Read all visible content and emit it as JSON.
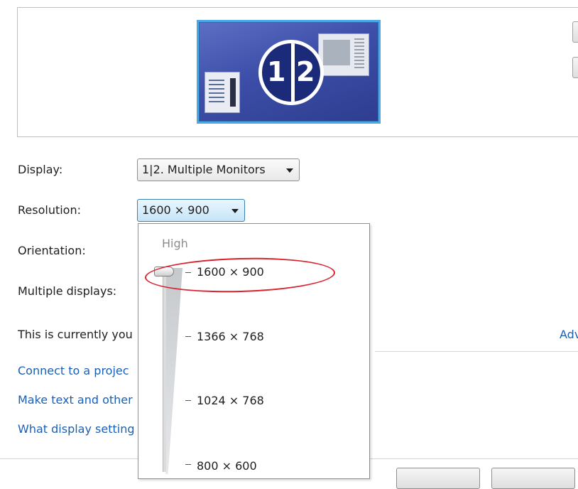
{
  "preview": {
    "monitor_badge_left": "1",
    "monitor_badge_right": "2",
    "accent_color": "#4aa8e8"
  },
  "fields": {
    "display_label": "Display:",
    "display_value": "1|2. Multiple Monitors",
    "resolution_label": "Resolution:",
    "resolution_value": "1600 × 900",
    "orientation_label": "Orientation:",
    "multiple_displays_label": "Multiple displays:"
  },
  "status": {
    "currently_text": "This is currently you",
    "advanced_link": "Adv"
  },
  "links": [
    {
      "label": "Connect to a projec"
    },
    {
      "label": "Make text and other"
    },
    {
      "label": "What display setting"
    }
  ],
  "resolution_popup": {
    "high_label": "High",
    "options": [
      "1600 × 900",
      "1366 × 768",
      "1024 × 768",
      "800 × 600"
    ],
    "selected": "1600 × 900",
    "highlight_color": "#d9232e"
  }
}
